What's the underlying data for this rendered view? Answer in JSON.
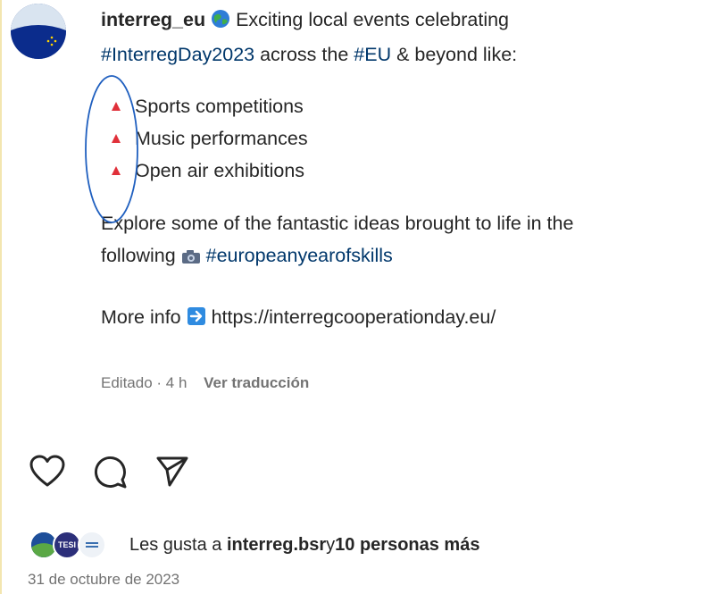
{
  "post": {
    "username": "interreg_eu",
    "intro_text": " Exciting local events celebrating",
    "hashtag_day": "#InterregDay2023",
    "text_across": " across the ",
    "hashtag_eu": "#EU",
    "text_beyond": " & beyond like:",
    "list_items": [
      "Sports competitions",
      "Music performances",
      "Open air exhibitions"
    ],
    "explore_line1": "Explore some of the fantastic ideas brought to life in the",
    "explore_following": "following ",
    "hashtag_skills": "#europeanyearofskills",
    "more_info": "More info ",
    "url": "https://interregcooperationday.eu/",
    "meta_time": "Editado · 4 h",
    "translate_label": "Ver traducción"
  },
  "actions": {
    "like_icon": "heart-icon",
    "comment_icon": "comment-icon",
    "share_icon": "send-icon"
  },
  "likes": {
    "prefix": "Les gusta a ",
    "user": "interreg.bsr",
    "middle": " y ",
    "others": "10 personas más",
    "face2_text": "TESI"
  },
  "date": "31 de octubre de 2023",
  "colors": {
    "hashtag": "#00376b",
    "triangle": "#e0303a",
    "meta": "#737373",
    "annotation": "#1f5fbf"
  }
}
